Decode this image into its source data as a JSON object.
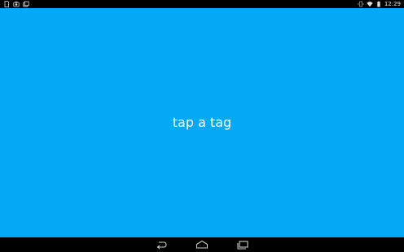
{
  "status_bar": {
    "left_icons": [
      "sim-card-icon",
      "camera-icon",
      "photos-icon"
    ],
    "right_icons": [
      "vibrate-icon",
      "wifi-icon",
      "battery-icon"
    ],
    "time": "12:29"
  },
  "main": {
    "message": "tap a tag",
    "background_color": "#03A9F4"
  },
  "nav_bar": {
    "buttons": [
      "back-icon",
      "home-icon",
      "recent-apps-icon"
    ]
  }
}
